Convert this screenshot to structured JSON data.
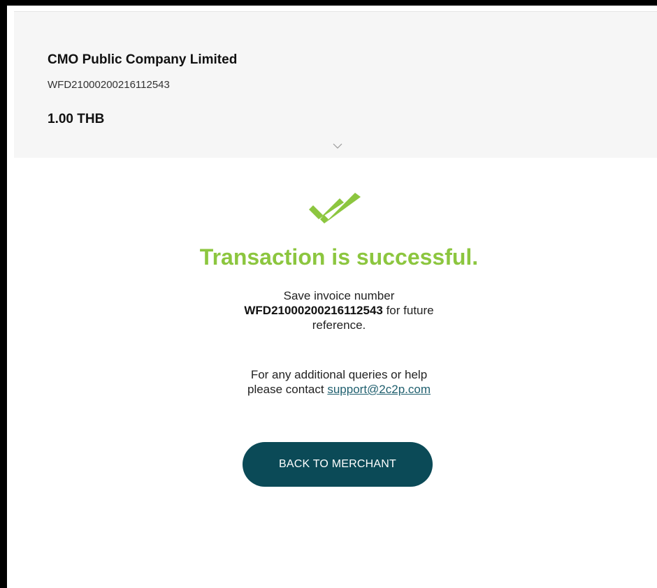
{
  "header": {
    "merchant_name": "CMO Public Company Limited",
    "invoice_id": "WFD21000200216112543",
    "amount": "1.00 THB",
    "toggle_icon": "chevron-down-icon"
  },
  "result": {
    "icon": "double-check-icon",
    "title": "Transaction is successful.",
    "save_prefix": "Save invoice number",
    "invoice_number": "WFD21000200216112543",
    "save_suffix": " for future reference.",
    "help_line1": "For any additional queries or help",
    "help_prefix": "please contact ",
    "support_email": "support@2c2p.com",
    "back_button_label": "BACK TO MERCHANT"
  },
  "colors": {
    "success_green": "#8cc63f",
    "button_teal": "#0b4a57",
    "link_teal": "#1f5f6e",
    "summary_bg": "#f6f6f6"
  }
}
